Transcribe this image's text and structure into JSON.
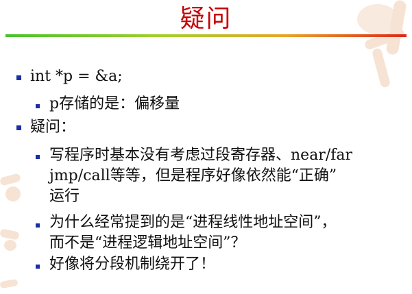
{
  "slide": {
    "title": "疑问",
    "accent": "#c60000",
    "bullet_color": "#1a2fa6",
    "rule_gradient": [
      "#49c22e",
      "#a6cf2f",
      "#e7a52c",
      "#e0271a"
    ],
    "bullets": [
      {
        "text": "int *p = &a;",
        "level": 1
      },
      {
        "text": "p存储的是：偏移量",
        "level": 2
      },
      {
        "text": "疑问：",
        "level": 1
      },
      {
        "lines": [
          "写程序时基本没有考虑过段寄存器、near/far",
          "jmp/call等等，但是程序好像依然能“正确”",
          "运行"
        ],
        "level": 2
      },
      {
        "lines": [
          "为什么经常提到的是“进程线性地址空间”，",
          "而不是“进程逻辑地址空间”？"
        ],
        "level": 2
      },
      {
        "text": "好像将分段机制绕开了！",
        "level": 2
      }
    ]
  }
}
